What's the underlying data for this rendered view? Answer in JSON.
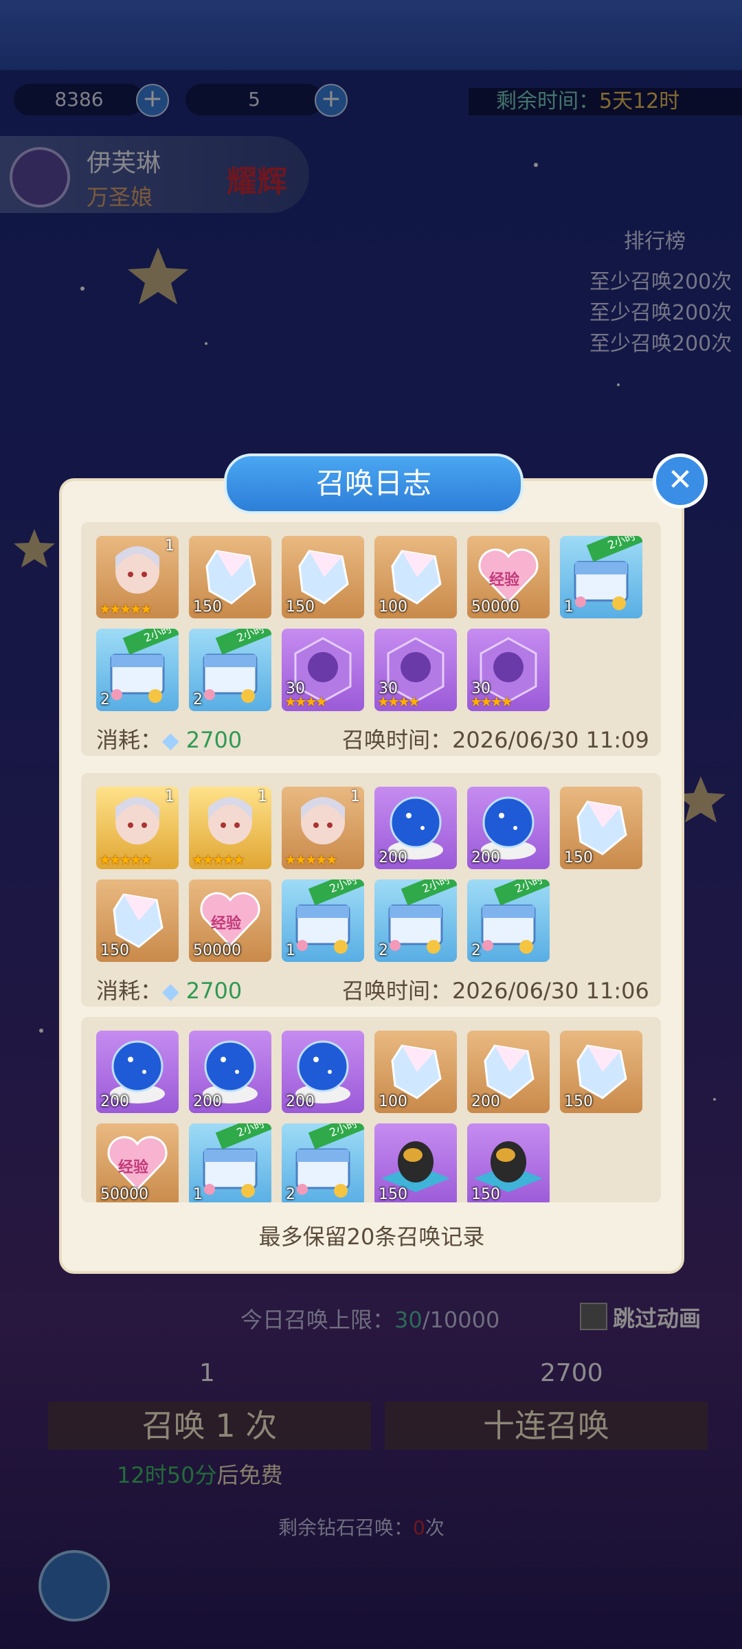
{
  "resources": {
    "diamond": "8386",
    "feather": "5"
  },
  "timer": {
    "label": "剩余时间：",
    "value": "5天12时"
  },
  "hero": {
    "name": "伊芙琳",
    "title": "万圣娘",
    "badge": "耀辉"
  },
  "ranking": {
    "title": "排行榜",
    "items": [
      "至少召唤200次",
      "至少召唤200次",
      "至少召唤200次"
    ]
  },
  "modal": {
    "title": "召唤日志",
    "footer": "最多保留20条召唤记录"
  },
  "records": [
    {
      "cost_label": "消耗：",
      "cost": "2700",
      "time_label": "召唤时间：",
      "time": "2026/06/30 11:09",
      "items": [
        {
          "type": "hero",
          "color": "orange",
          "qty": "",
          "level": "1",
          "stars": "★★★★★"
        },
        {
          "type": "crystal",
          "color": "orange",
          "qty": "150"
        },
        {
          "type": "crystal",
          "color": "orange",
          "qty": "150"
        },
        {
          "type": "crystal",
          "color": "orange",
          "qty": "100"
        },
        {
          "type": "exp-heart",
          "color": "orange",
          "qty": "50000"
        },
        {
          "type": "chest",
          "color": "blue",
          "qty": "1",
          "tag": "2小时"
        },
        {
          "type": "chest",
          "color": "blue",
          "qty": "2",
          "tag": "2小时"
        },
        {
          "type": "chest",
          "color": "blue",
          "qty": "2",
          "tag": "2小时"
        },
        {
          "type": "shard",
          "color": "purple",
          "qty": "30",
          "stars": "★★★★"
        },
        {
          "type": "shard",
          "color": "purple",
          "qty": "30",
          "stars": "★★★★"
        },
        {
          "type": "shard",
          "color": "purple",
          "qty": "30",
          "stars": "★★★★"
        }
      ]
    },
    {
      "cost_label": "消耗：",
      "cost": "2700",
      "time_label": "召唤时间：",
      "time": "2026/06/30 11:06",
      "items": [
        {
          "type": "hero",
          "color": "gold",
          "qty": "",
          "level": "1",
          "stars": "★★★★★"
        },
        {
          "type": "hero",
          "color": "gold",
          "qty": "",
          "level": "1",
          "stars": "★★★★★"
        },
        {
          "type": "hero",
          "color": "orange",
          "qty": "",
          "level": "1",
          "stars": "★★★★★"
        },
        {
          "type": "orb",
          "color": "purple",
          "qty": "200"
        },
        {
          "type": "orb",
          "color": "purple",
          "qty": "200"
        },
        {
          "type": "crystal",
          "color": "orange",
          "qty": "150"
        },
        {
          "type": "crystal",
          "color": "orange",
          "qty": "150"
        },
        {
          "type": "exp-heart",
          "color": "orange",
          "qty": "50000"
        },
        {
          "type": "chest",
          "color": "blue",
          "qty": "1",
          "tag": "2小时"
        },
        {
          "type": "chest",
          "color": "blue",
          "qty": "2",
          "tag": "2小时"
        },
        {
          "type": "chest",
          "color": "blue",
          "qty": "2",
          "tag": "2小时"
        }
      ]
    },
    {
      "items": [
        {
          "type": "orb",
          "color": "purple",
          "qty": "200"
        },
        {
          "type": "orb",
          "color": "purple",
          "qty": "200"
        },
        {
          "type": "orb",
          "color": "purple",
          "qty": "200"
        },
        {
          "type": "crystal",
          "color": "orange",
          "qty": "100"
        },
        {
          "type": "crystal",
          "color": "orange",
          "qty": "200"
        },
        {
          "type": "crystal",
          "color": "orange",
          "qty": "150"
        },
        {
          "type": "exp-heart",
          "color": "orange",
          "qty": "50000"
        },
        {
          "type": "chest",
          "color": "blue",
          "qty": "1",
          "tag": "2小时"
        },
        {
          "type": "chest",
          "color": "blue",
          "qty": "2",
          "tag": "2小时"
        },
        {
          "type": "egg",
          "color": "purple",
          "qty": "150"
        },
        {
          "type": "egg",
          "color": "purple",
          "qty": "150"
        }
      ]
    }
  ],
  "exp_text": "经验",
  "bottom": {
    "daily_label": "今日召唤上限：",
    "daily_used": "30",
    "daily_max": "/10000",
    "skip_anim": "跳过动画",
    "feather_cost": "1",
    "diamond_cost": "2700",
    "single": "召唤 1 次",
    "ten": "十连召唤",
    "free_time": "12时50分",
    "free_suffix": "后免费",
    "remaining_label": "剩余钻石召唤：",
    "remaining_suffix": "次"
  }
}
